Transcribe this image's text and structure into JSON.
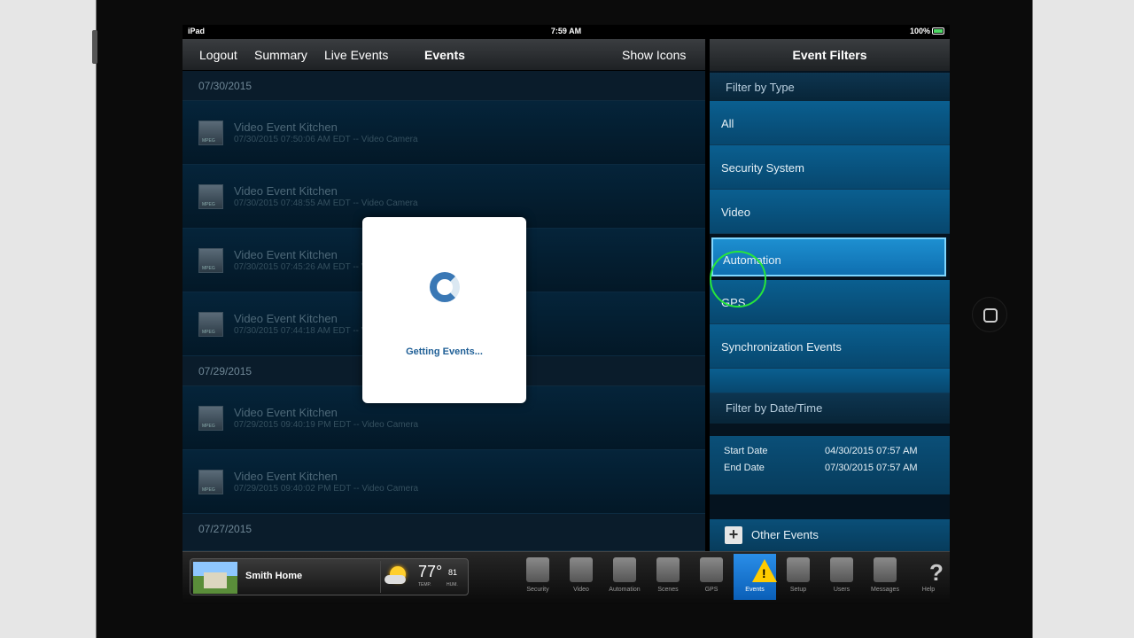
{
  "status": {
    "device": "iPad",
    "time": "7:59 AM",
    "battery": "100%"
  },
  "nav": {
    "logout": "Logout",
    "summary": "Summary",
    "live_events": "Live Events",
    "events": "Events",
    "show_icons": "Show Icons"
  },
  "groups": [
    {
      "date": "07/30/2015",
      "events": [
        {
          "title": "Video Event  Kitchen",
          "detail": "07/30/2015 07:50:06 AM EDT  --  Video Camera"
        },
        {
          "title": "Video Event  Kitchen",
          "detail": "07/30/2015 07:48:55 AM EDT  --  Video Camera"
        },
        {
          "title": "Video Event  Kitchen",
          "detail": "07/30/2015 07:45:26 AM EDT  --  Video Camera"
        },
        {
          "title": "Video Event  Kitchen",
          "detail": "07/30/2015 07:44:18 AM EDT  --  Video Camera"
        }
      ]
    },
    {
      "date": "07/29/2015",
      "events": [
        {
          "title": "Video Event  Kitchen",
          "detail": "07/29/2015 09:40:19 PM EDT  --  Video Camera"
        },
        {
          "title": "Video Event  Kitchen",
          "detail": "07/29/2015 09:40:02 PM EDT  --  Video Camera"
        }
      ]
    },
    {
      "date": "07/27/2015",
      "events": []
    }
  ],
  "loading": {
    "message": "Getting Events..."
  },
  "filters": {
    "title": "Event Filters",
    "by_type_label": "Filter by Type",
    "types": [
      "All",
      "Security System",
      "Video",
      "Automation",
      "GPS",
      "Synchronization Events"
    ],
    "selected_type": "Automation",
    "by_date_label": "Filter by Date/Time",
    "start_label": "Start Date",
    "start_value": "04/30/2015   07:57 AM",
    "end_label": "End Date",
    "end_value": "07/30/2015   07:57 AM",
    "other_events": "Other Events"
  },
  "home": {
    "name": "Smith Home",
    "temp": "77°",
    "humidity": "81",
    "temp_label": "TEMP.",
    "hum_label": "HUM."
  },
  "tabs": [
    "Security",
    "Video",
    "Automation",
    "Scenes",
    "GPS",
    "Events",
    "Setup",
    "Users",
    "Messages",
    "Help"
  ],
  "active_tab": "Events",
  "colors": {
    "accent": "#1d8fd0",
    "highlight_ring": "#27e63b",
    "warning": "#ffcc00"
  }
}
